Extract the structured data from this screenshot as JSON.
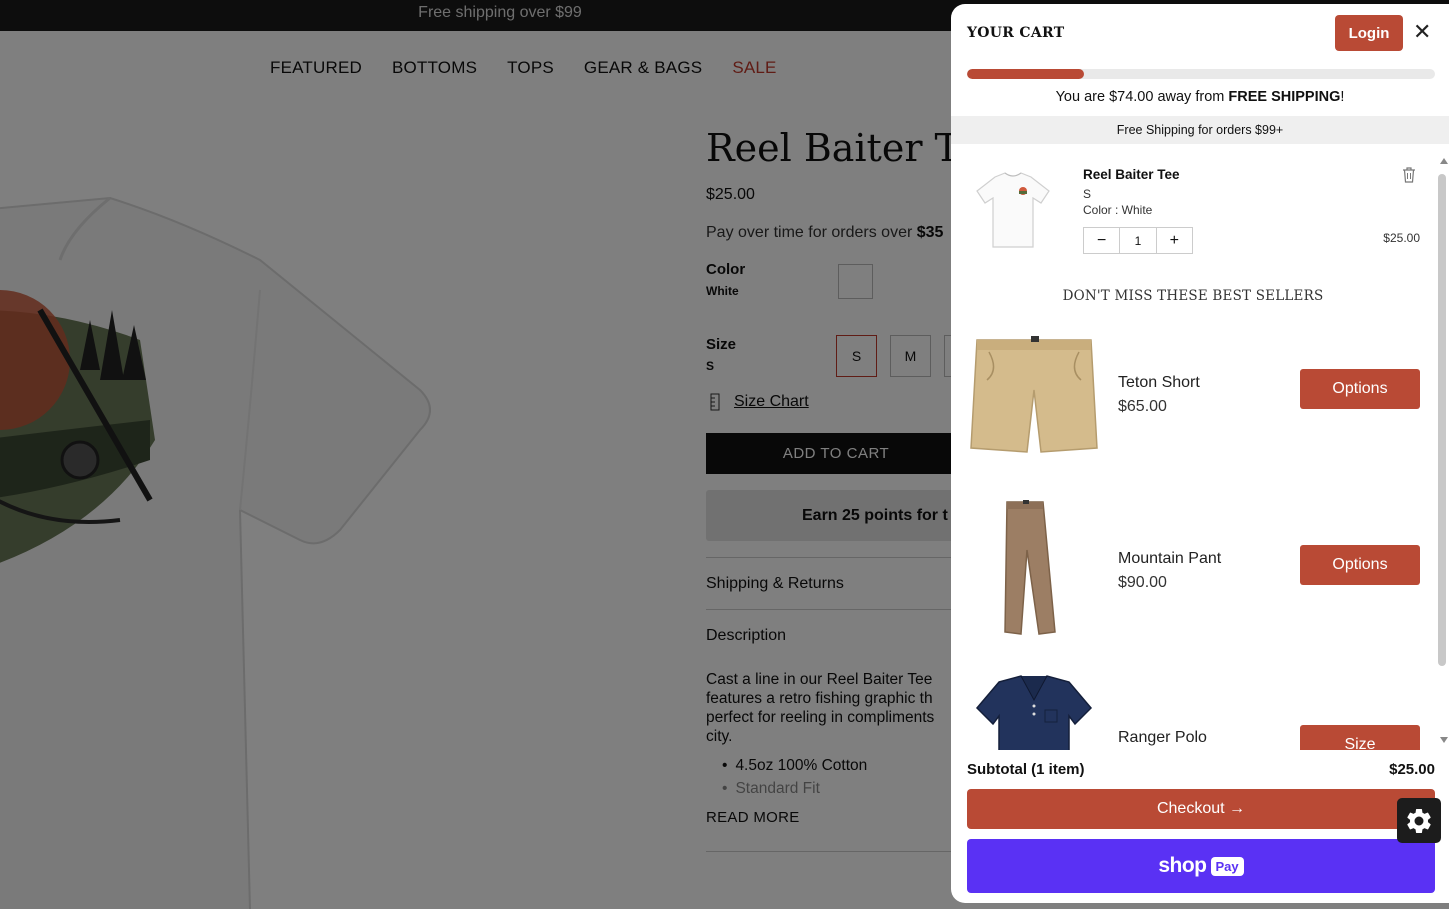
{
  "announcement": "Free shipping over $99",
  "nav": {
    "items": [
      "FEATURED",
      "BOTTOMS",
      "TOPS",
      "GEAR & BAGS"
    ],
    "sale": "SALE"
  },
  "product": {
    "title": "Reel Baiter Tee",
    "price": "$25.00",
    "pay_text": "Pay over time for orders over",
    "pay_amount": "$35",
    "color_label": "Color",
    "color_value": "White",
    "size_label": "Size",
    "size_value": "S",
    "sizes": [
      "S",
      "M"
    ],
    "size_chart": "Size Chart",
    "add_to_cart": "ADD TO CART",
    "earn_points": "Earn 25 points for t",
    "shipping_returns": "Shipping & Returns",
    "description_label": "Description",
    "description_lines": [
      "Cast a line in our Reel Baiter Tee",
      "features a retro fishing graphic th",
      "perfect for reeling in compliments",
      "city."
    ],
    "bullets": [
      "4.5oz 100% Cotton",
      "Standard Fit"
    ],
    "read_more": "READ MORE"
  },
  "cart": {
    "title": "YOUR CART",
    "login": "Login",
    "close_icon": "close-icon",
    "progress": 0.25,
    "ship_msg_pre": "You are $74.00 away from ",
    "ship_msg_bold": "FREE SHIPPING",
    "ship_msg_post": "!",
    "ship_bar": "Free Shipping for orders $99+",
    "item": {
      "name": "Reel Baiter Tee",
      "size": "S",
      "color": "Color : White",
      "qty": "1",
      "minus": "−",
      "plus": "+",
      "price": "$25.00"
    },
    "best_sellers_title": "DON'T MISS THESE BEST SELLERS",
    "recommendations": [
      {
        "name": "Teton Short",
        "price": "$65.00",
        "button": "Options"
      },
      {
        "name": "Mountain Pant",
        "price": "$90.00",
        "button": "Options"
      },
      {
        "name": "Ranger Polo",
        "price": "",
        "button": "Size"
      }
    ],
    "subtotal_label": "Subtotal (1 item)",
    "subtotal_value": "$25.00",
    "checkout": "Checkout →",
    "shoppay_shop": "shop",
    "shoppay_pay": "Pay"
  },
  "colors": {
    "accent": "#b94a35",
    "shoppay": "#5a31f4",
    "sale": "#c0392b"
  }
}
